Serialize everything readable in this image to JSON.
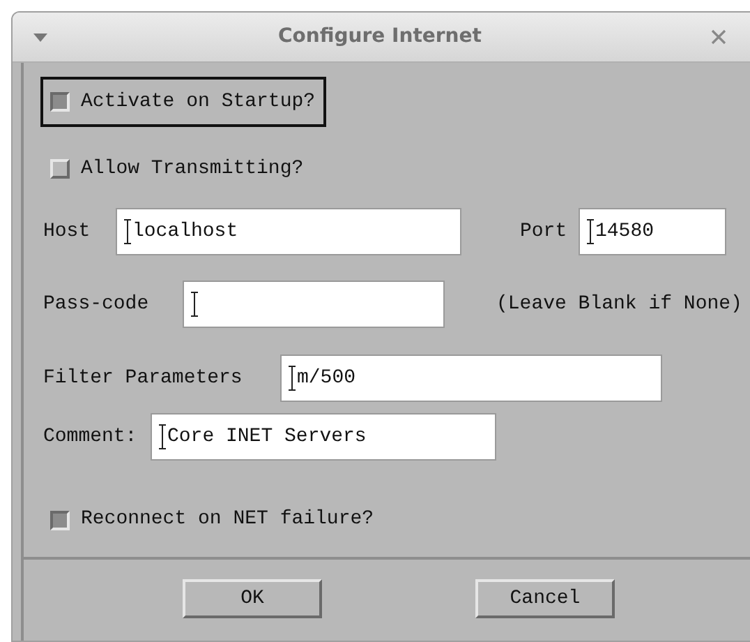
{
  "window": {
    "title": "Configure Internet"
  },
  "options": [
    {
      "label": "Activate on Startup?",
      "checked": true,
      "focused": true
    },
    {
      "label": "Allow Transmitting?",
      "checked": false,
      "focused": false
    }
  ],
  "host": {
    "label": "Host",
    "value": "localhost"
  },
  "port": {
    "label": "Port",
    "value": "14580"
  },
  "passcode": {
    "label": "Pass-code",
    "note": "(Leave Blank if None)"
  },
  "filter": {
    "label": "Filter Parameters",
    "value": "m/500"
  },
  "comment": {
    "label": "Comment:",
    "value": "Core INET Servers"
  },
  "reconnect": {
    "label": "Reconnect on NET failure?",
    "checked": true
  },
  "buttons": [
    "OK",
    "Cancel"
  ]
}
